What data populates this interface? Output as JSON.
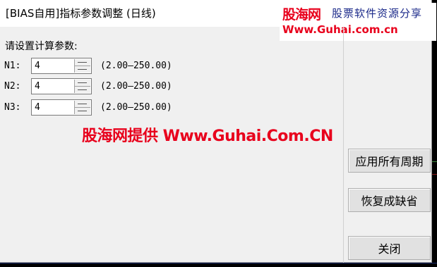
{
  "window": {
    "title": "[BIAS自用]指标参数调整 (日线)"
  },
  "watermark": {
    "logo": "股海网",
    "tagline": "股票软件资源分享",
    "url": "Www.Guhai.com.cn",
    "center_text": "股海网提供 Www.Guhai.Com.CN"
  },
  "params": {
    "heading": "请设置计算参数:",
    "rows": [
      {
        "label": "N1:",
        "value": "4",
        "range": "(2.00—250.00)"
      },
      {
        "label": "N2:",
        "value": "4",
        "range": "(2.00—250.00)"
      },
      {
        "label": "N3:",
        "value": "4",
        "range": "(2.00—250.00)"
      }
    ]
  },
  "buttons": {
    "apply_all": "应用所有周期",
    "restore_default": "恢复成缺省",
    "close": "关闭"
  },
  "colors": {
    "watermark_red": "#e8001c",
    "watermark_blue": "#1b2a8a",
    "dialog_bg": "#f0f0f0"
  }
}
